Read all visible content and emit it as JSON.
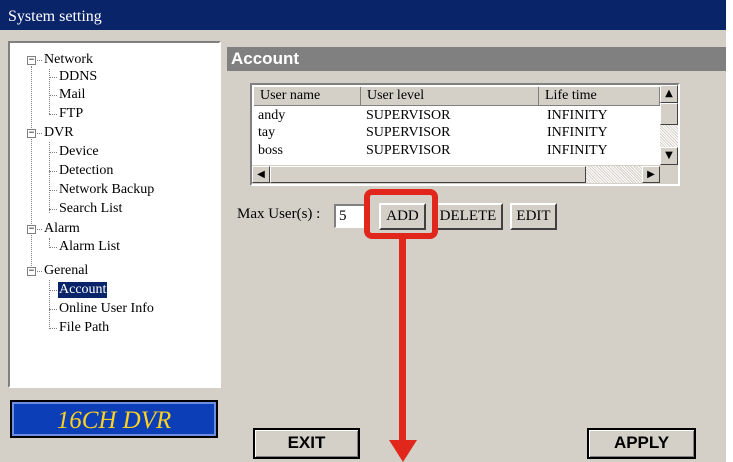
{
  "window": {
    "title": "System setting"
  },
  "tree": {
    "groups": [
      {
        "label": "Network",
        "items": [
          "DDNS",
          "Mail",
          "FTP"
        ]
      },
      {
        "label": "DVR",
        "items": [
          "Device",
          "Detection",
          "Network Backup",
          "Search List"
        ]
      },
      {
        "label": "Alarm",
        "items": [
          "Alarm List"
        ]
      },
      {
        "label": "Gerenal",
        "items": [
          "Account",
          "Online User Info",
          "File Path"
        ]
      }
    ],
    "selected": "Account"
  },
  "logo": {
    "text": "16CH DVR"
  },
  "panel": {
    "title": "Account",
    "table": {
      "columns": [
        "User name",
        "User level",
        "Life time"
      ],
      "rows": [
        [
          "andy",
          "SUPERVISOR",
          "INFINITY"
        ],
        [
          "tay",
          "SUPERVISOR",
          "INFINITY"
        ],
        [
          "boss",
          "SUPERVISOR",
          "INFINITY"
        ]
      ]
    },
    "max_users_label": "Max User(s) :",
    "max_users_value": "5",
    "add_label": "ADD",
    "delete_label": "DELETE",
    "edit_label": "EDIT"
  },
  "footer": {
    "exit_label": "EXIT",
    "apply_label": "APPLY"
  },
  "colors": {
    "titlebar": "#0a246a",
    "annotation": "#e1261c",
    "logo_bg": "#0c3fb7",
    "logo_text": "#ffd21f"
  }
}
